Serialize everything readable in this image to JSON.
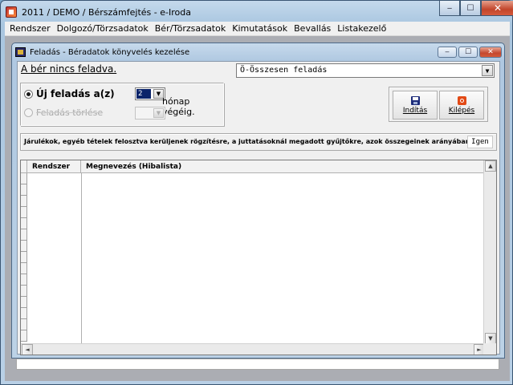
{
  "app": {
    "title": "2011 / DEMO / Bérszámfejtés - e-Iroda",
    "caption_buttons": {
      "minimize": "‒",
      "maximize": "☐",
      "close": "✕"
    }
  },
  "menubar": {
    "items": [
      {
        "label": "Rendszer"
      },
      {
        "label": "Dolgozó/Törzsadatok"
      },
      {
        "label": "Bér/Törzsadatok"
      },
      {
        "label": "Kimutatások"
      },
      {
        "label": "Bevallás"
      },
      {
        "label": "Listakezelő"
      }
    ]
  },
  "dialog": {
    "title": "Feladás - Béradatok könyvelés kezelése",
    "caption_buttons": {
      "minimize": "‒",
      "maximize": "☐",
      "close": "✕"
    },
    "notice": "A bér nincs feladva.",
    "mode_combo": {
      "value": "Ö-Összesen feladás",
      "arrow": "▼"
    },
    "options": {
      "new_posting": {
        "label": "Új feladás a(z)",
        "selected": true
      },
      "delete_posting": {
        "label": "Feladás törlése",
        "selected": false
      },
      "month": {
        "value": "2",
        "arrow": "▼"
      },
      "month_suffix": "hónap végéig."
    },
    "buttons": {
      "start": {
        "label": "Indítás",
        "icon": "floppy-disk-icon"
      },
      "exit": {
        "label": "Kilépés",
        "icon": "exit-icon"
      }
    },
    "info": {
      "text": "Járulékok, egyéb tételek felosztva kerüljenek rögzítésre, a juttatásoknál megadott gyűjtőkre, azok összegeinek arányában",
      "value": "Igen"
    },
    "grid": {
      "columns": [
        "Rendszer",
        "Megnevezés (Hibalista)"
      ],
      "rows": []
    },
    "scroll": {
      "up": "▲",
      "down": "▼",
      "left": "◄",
      "right": "►"
    }
  }
}
